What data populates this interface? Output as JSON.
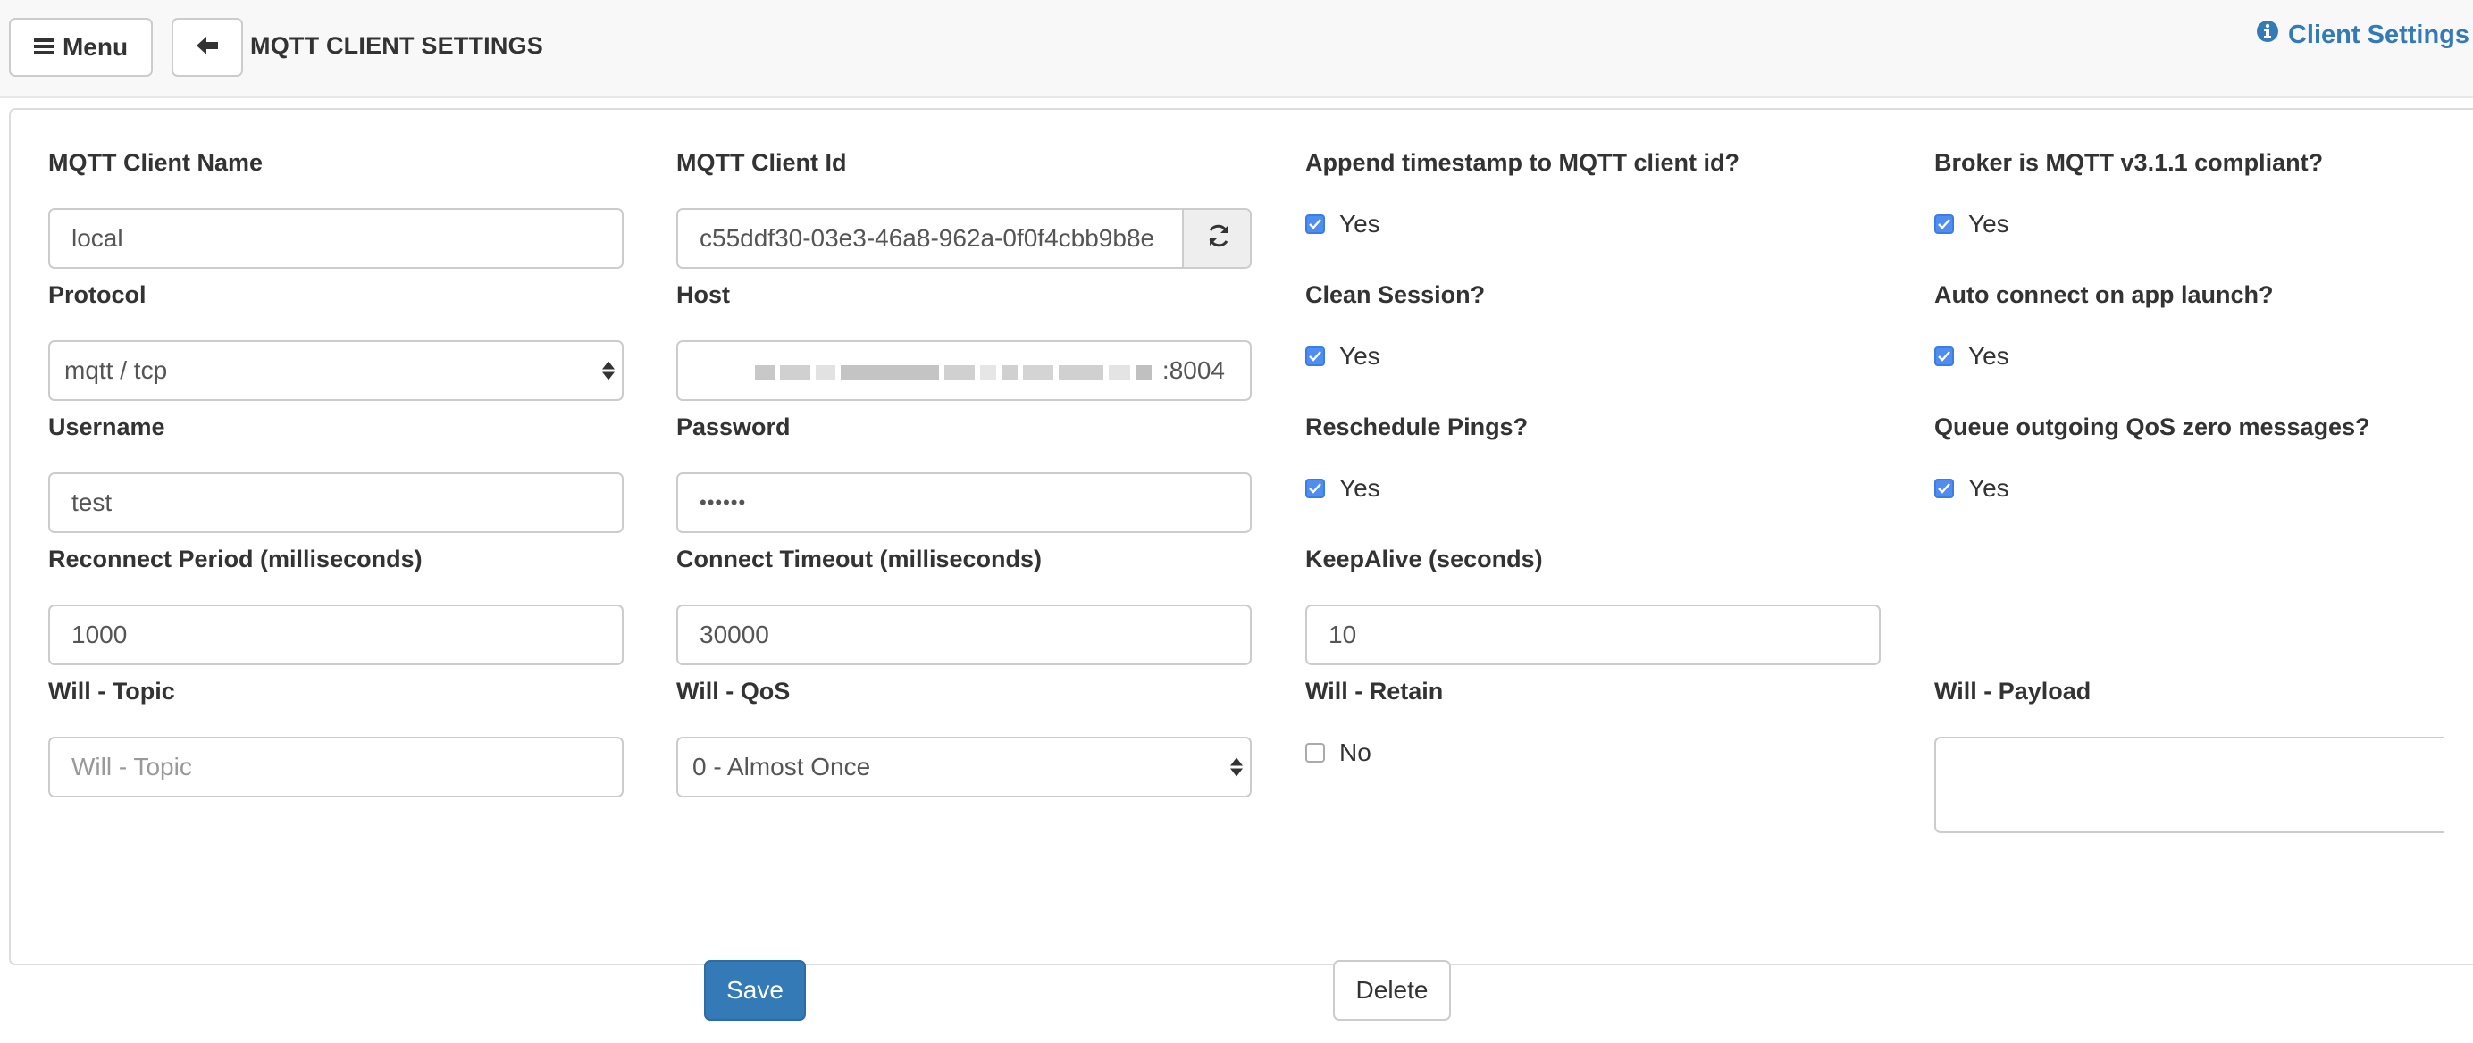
{
  "header": {
    "menu_label": "Menu",
    "title": "MQTT CLIENT SETTINGS",
    "help_link": "Client Settings"
  },
  "form": {
    "client_name": {
      "label": "MQTT Client Name",
      "value": "local"
    },
    "client_id": {
      "label": "MQTT Client Id",
      "value": "c55ddf30-03e3-46a8-962a-0f0f4cbb9b8e"
    },
    "append_timestamp": {
      "label": "Append timestamp to MQTT client id?",
      "option": "Yes",
      "checked": true
    },
    "broker_compliant": {
      "label": "Broker is MQTT v3.1.1 compliant?",
      "option": "Yes",
      "checked": true
    },
    "protocol": {
      "label": "Protocol",
      "value": "mqtt / tcp"
    },
    "host": {
      "label": "Host",
      "value_suffix": ":8004"
    },
    "clean_session": {
      "label": "Clean Session?",
      "option": "Yes",
      "checked": true
    },
    "auto_connect": {
      "label": "Auto connect on app launch?",
      "option": "Yes",
      "checked": true
    },
    "username": {
      "label": "Username",
      "value": "test"
    },
    "password": {
      "label": "Password",
      "value": "••••••"
    },
    "reschedule_pings": {
      "label": "Reschedule Pings?",
      "option": "Yes",
      "checked": true
    },
    "queue_qos_zero": {
      "label": "Queue outgoing QoS zero messages?",
      "option": "Yes",
      "checked": true
    },
    "reconnect_period": {
      "label": "Reconnect Period (milliseconds)",
      "value": "1000"
    },
    "connect_timeout": {
      "label": "Connect Timeout (milliseconds)",
      "value": "30000"
    },
    "keepalive": {
      "label": "KeepAlive (seconds)",
      "value": "10"
    },
    "will_topic": {
      "label": "Will - Topic",
      "placeholder": "Will - Topic"
    },
    "will_qos": {
      "label": "Will - QoS",
      "value": "0 - Almost Once"
    },
    "will_retain": {
      "label": "Will - Retain",
      "option": "No",
      "checked": false
    },
    "will_payload": {
      "label": "Will - Payload",
      "value": ""
    }
  },
  "actions": {
    "save_label": "Save",
    "delete_label": "Delete"
  },
  "colors": {
    "accent": "#337ab7",
    "checkbox": "#4f8ef0"
  }
}
